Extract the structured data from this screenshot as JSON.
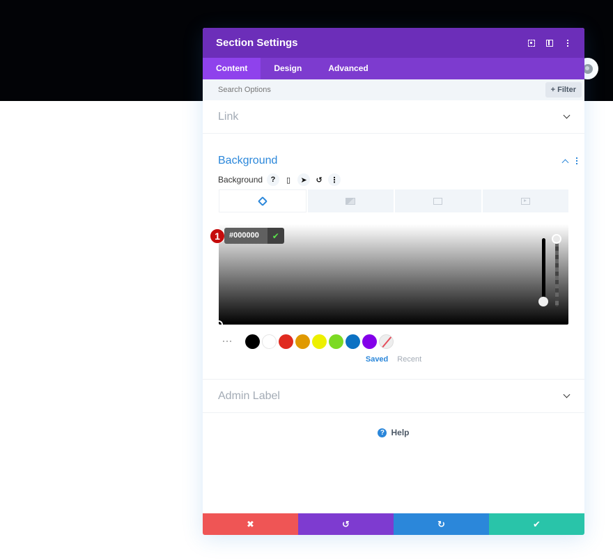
{
  "modal": {
    "title": "Section Settings",
    "header_icons": [
      "focus-icon",
      "split-view-icon",
      "more-options-icon"
    ]
  },
  "tabs": [
    {
      "label": "Content",
      "active": true
    },
    {
      "label": "Design",
      "active": false
    },
    {
      "label": "Advanced",
      "active": false
    }
  ],
  "search": {
    "placeholder": "Search Options",
    "filter_label": "Filter",
    "filter_icon": "+"
  },
  "sections": {
    "link": {
      "title": "Link",
      "expanded": false
    },
    "background": {
      "title": "Background",
      "expanded": true,
      "field_label": "Background",
      "field_icons": {
        "help": "?",
        "responsive": "▯",
        "hover": "➤",
        "reset": "↺",
        "more": "⋮"
      },
      "type_tabs": [
        {
          "name": "color",
          "icon": "paint-bucket-icon",
          "active": true
        },
        {
          "name": "gradient",
          "icon": "gradient-icon",
          "active": false
        },
        {
          "name": "image",
          "icon": "image-icon",
          "active": false
        },
        {
          "name": "video",
          "icon": "video-icon",
          "active": false
        }
      ],
      "color_picker": {
        "hex_value": "#000000",
        "confirm_icon": "✔",
        "step_badge": "1"
      },
      "swatches": [
        "#000000",
        "#ffffff",
        "#e02b20",
        "#e09900",
        "#edf000",
        "#7cda24",
        "#0c71c3",
        "#8300e9",
        "none"
      ],
      "palette_tabs": {
        "saved": "Saved",
        "recent": "Recent"
      }
    },
    "admin_label": {
      "title": "Admin Label",
      "expanded": false
    }
  },
  "help": {
    "label": "Help",
    "icon": "?"
  },
  "footer": {
    "buttons": [
      {
        "name": "cancel",
        "icon": "✖",
        "color": "#ef5555"
      },
      {
        "name": "undo",
        "icon": "↺",
        "color": "#7e3bd0"
      },
      {
        "name": "redo",
        "icon": "↻",
        "color": "#2b87da"
      },
      {
        "name": "save",
        "icon": "✔",
        "color": "#29c4a9"
      }
    ]
  },
  "colors": {
    "header": "#6c2eb9",
    "tabs_bar": "#7d3bcf",
    "active_tab": "#8f42ec",
    "accent_blue": "#2b87da",
    "hero_bg": "#020306"
  }
}
